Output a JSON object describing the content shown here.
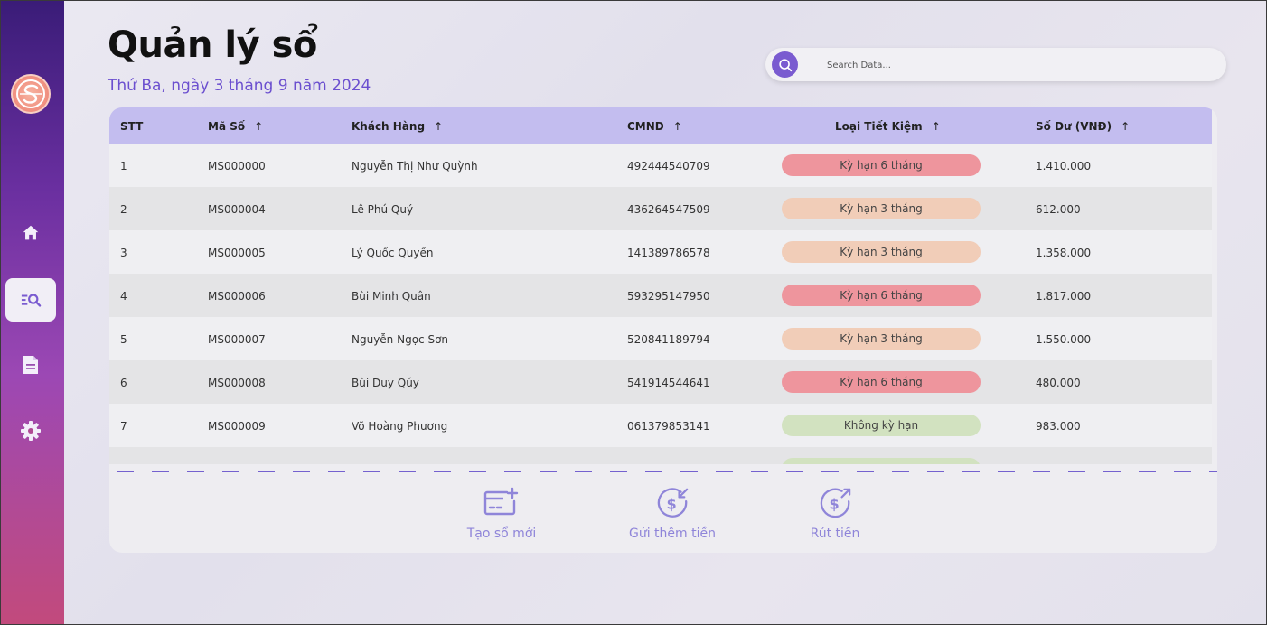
{
  "header": {
    "title": "Quản lý sổ",
    "date": "Thứ Ba, ngày 3 tháng 9 năm 2024"
  },
  "search": {
    "placeholder": "Search Data..."
  },
  "sidebar": {
    "items": [
      {
        "icon": "home-icon",
        "active": false
      },
      {
        "icon": "search-list-icon",
        "active": true
      },
      {
        "icon": "document-icon",
        "active": false
      },
      {
        "icon": "gear-icon",
        "active": false
      }
    ]
  },
  "table": {
    "columns": [
      "STT",
      "Mã Số",
      "Khách Hàng",
      "CMND",
      "Loại Tiết Kiệm",
      "Số Dư (VNĐ)"
    ],
    "sort_arrow": "↑",
    "rows": [
      {
        "stt": "1",
        "ma_so": "MS000000",
        "khach_hang": "Nguyễn Thị Như Quỳnh",
        "cmnd": "492444540709",
        "loai": "Kỳ hạn 6 tháng",
        "so_du": "1.410.000"
      },
      {
        "stt": "2",
        "ma_so": "MS000004",
        "khach_hang": "Lê Phú Quý",
        "cmnd": "436264547509",
        "loai": "Kỳ hạn 3 tháng",
        "so_du": "612.000"
      },
      {
        "stt": "3",
        "ma_so": "MS000005",
        "khach_hang": "Lý Quốc Quyền",
        "cmnd": "141389786578",
        "loai": "Kỳ hạn 3 tháng",
        "so_du": "1.358.000"
      },
      {
        "stt": "4",
        "ma_so": "MS000006",
        "khach_hang": "Bùi Minh Quân",
        "cmnd": "593295147950",
        "loai": "Kỳ hạn 6 tháng",
        "so_du": "1.817.000"
      },
      {
        "stt": "5",
        "ma_so": "MS000007",
        "khach_hang": "Nguyễn Ngọc Sơn",
        "cmnd": "520841189794",
        "loai": "Kỳ hạn 3 tháng",
        "so_du": "1.550.000"
      },
      {
        "stt": "6",
        "ma_so": "MS000008",
        "khach_hang": "Bùi Duy Qúy",
        "cmnd": "541914544641",
        "loai": "Kỳ hạn 6 tháng",
        "so_du": "480.000"
      },
      {
        "stt": "7",
        "ma_so": "MS000009",
        "khach_hang": "Võ Hoàng Phương",
        "cmnd": "061379853141",
        "loai": "Không kỳ hạn",
        "so_du": "983.000"
      }
    ]
  },
  "actions": {
    "create": "Tạo sổ mới",
    "deposit": "Gửi thêm tiền",
    "withdraw": "Rút tiền"
  },
  "colors": {
    "accent": "#7a5bd0",
    "header_row": "#c3bdef",
    "term_6": "#ee959d",
    "term_3": "#f1cdb8",
    "no_term": "#d2e2c0"
  }
}
